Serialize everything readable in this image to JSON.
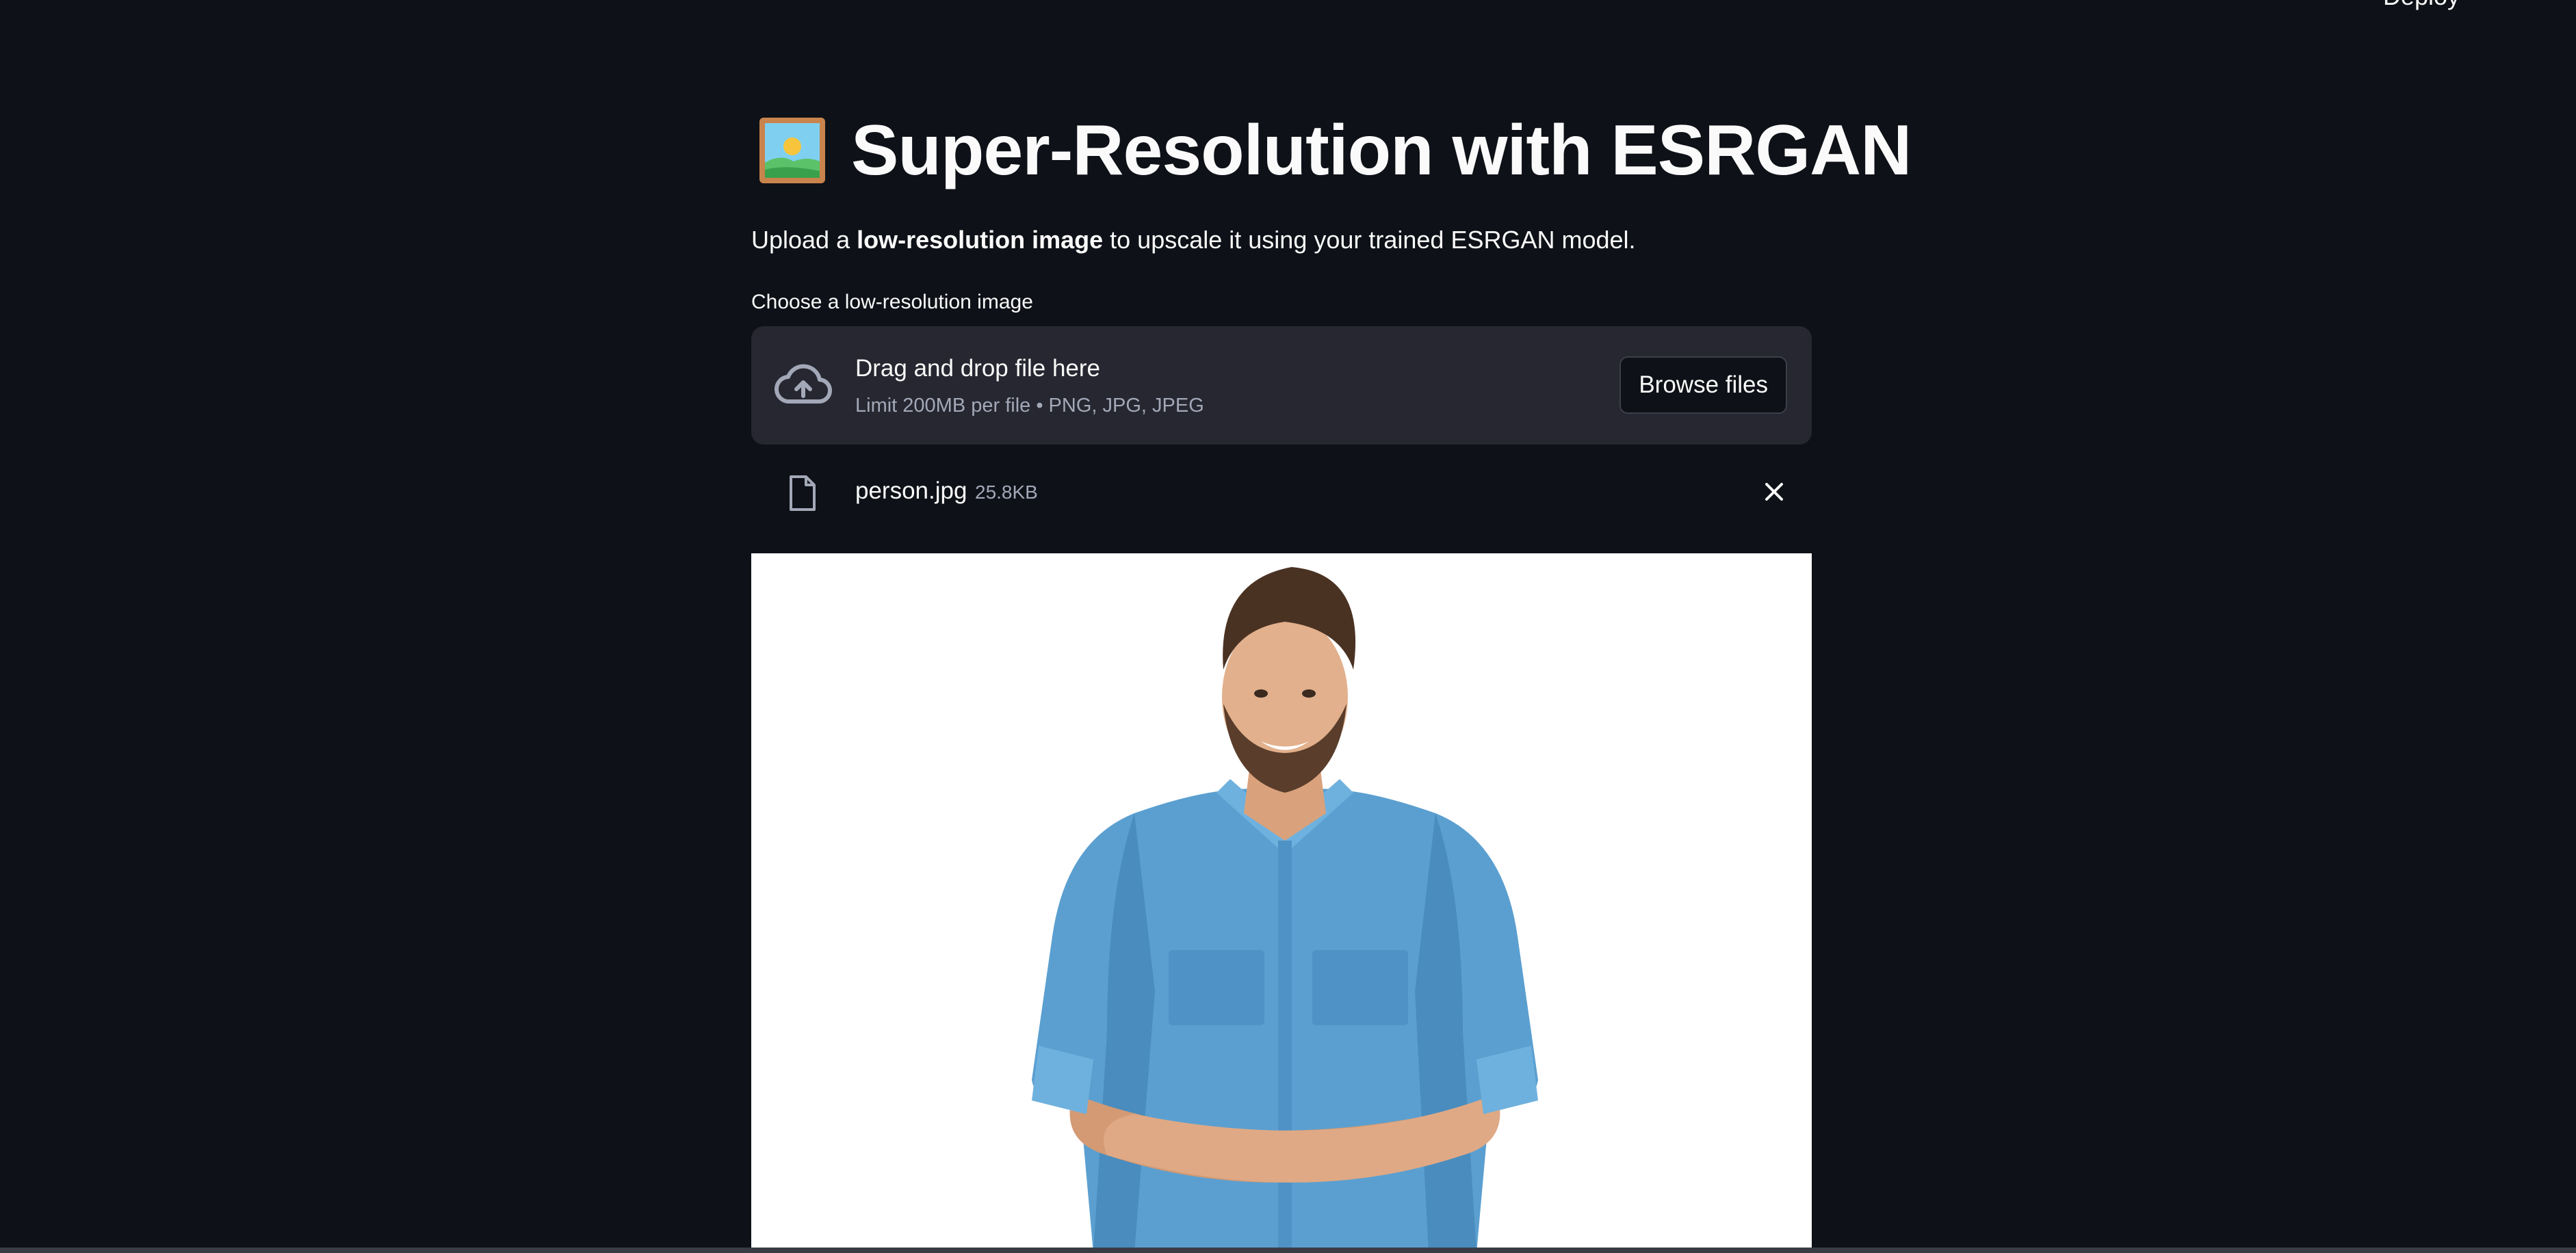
{
  "header": {
    "deploy_label": "Deploy",
    "menu_icon": "more-vert-icon"
  },
  "main": {
    "title_icon": "framed-picture-icon",
    "title": "Super-Resolution with ESRGAN",
    "subtitle": {
      "prefix": "Upload a ",
      "bold": "low-resolution image",
      "suffix": " to upscale it using your trained ESRGAN model."
    },
    "uploader": {
      "label": "Choose a low-resolution image",
      "icon": "cloud-upload-icon",
      "drop_title": "Drag and drop file here",
      "drop_limit": "Limit 200MB per file • PNG, JPG, JPEG",
      "browse_label": "Browse files"
    },
    "uploaded_file": {
      "icon": "file-icon",
      "name": "person.jpg",
      "size": "25.8KB",
      "remove_icon": "close-icon"
    },
    "preview": {
      "description_icon": "person-photo"
    }
  },
  "colors": {
    "background": "#0e1117",
    "dropzone": "#262730",
    "text": "#fafafa",
    "muted_text": "#a3a8b8",
    "shirt": "#5b9fd0"
  }
}
